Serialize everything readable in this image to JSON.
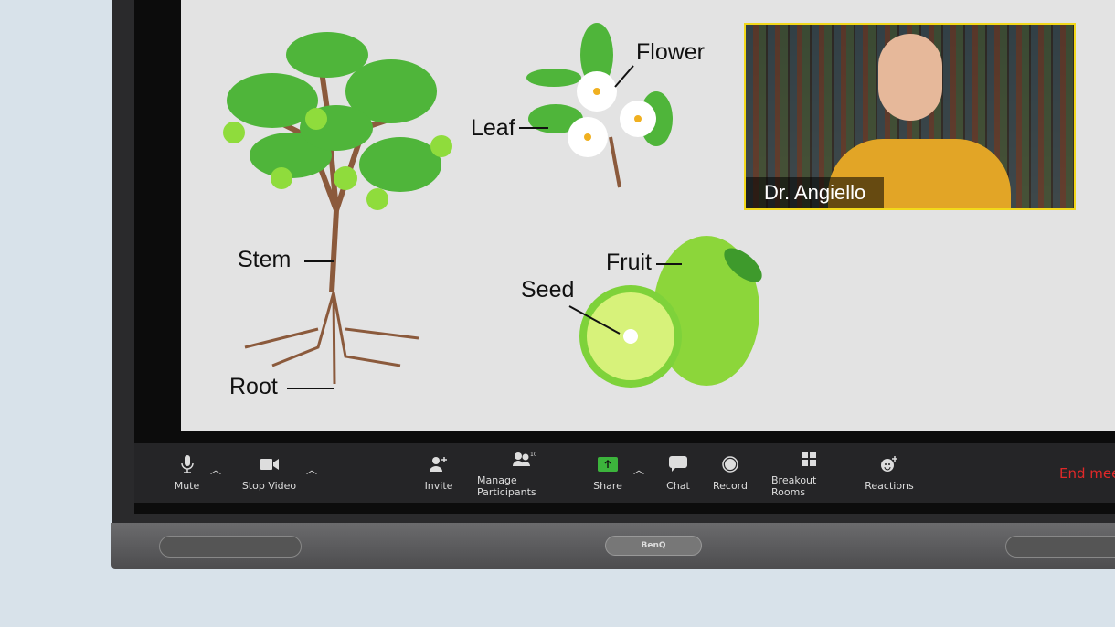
{
  "slide": {
    "labels": {
      "flower": "Flower",
      "leaf": "Leaf",
      "stem": "Stem",
      "root": "Root",
      "fruit": "Fruit",
      "seed": "Seed"
    }
  },
  "video": {
    "participant_name": "Dr. Angiello",
    "highlight_color": "#f2d81b"
  },
  "toolbar": {
    "mute": "Mute",
    "stop_video": "Stop Video",
    "invite": "Invite",
    "manage_participants": "Manage Participants",
    "participant_count": "10",
    "share": "Share",
    "chat": "Chat",
    "record": "Record",
    "breakout_rooms": "Breakout Rooms",
    "reactions": "Reactions",
    "end_meeting": "End mee",
    "share_color": "#3cb43c",
    "end_color": "#e02828"
  },
  "device": {
    "brand": "BenQ"
  }
}
